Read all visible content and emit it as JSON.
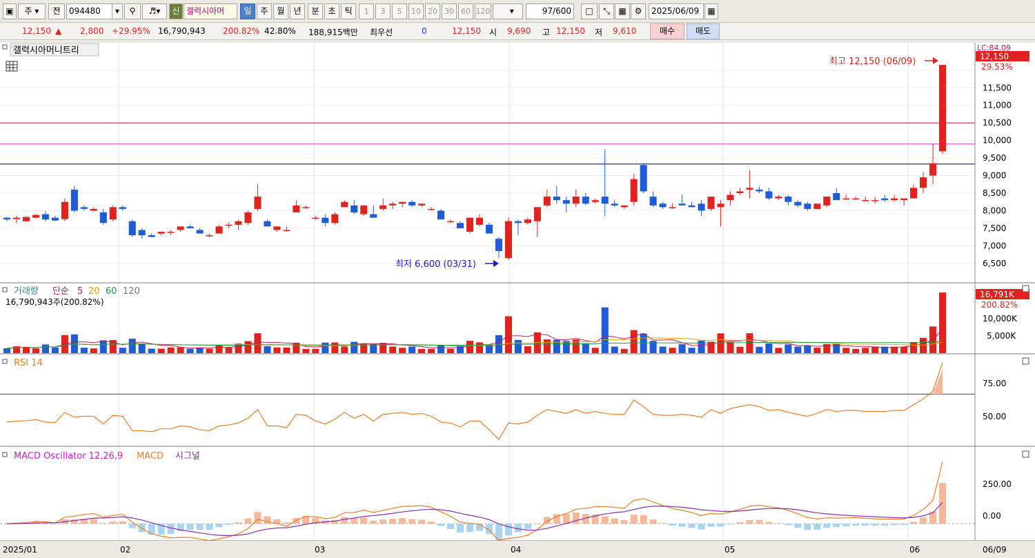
{
  "toolbar": {
    "period_select": "주",
    "prev_label": "전",
    "stock_code": "094480",
    "new_badge": "신",
    "stock_name": "갤럭시아머",
    "period_tabs": [
      "일",
      "주",
      "월",
      "년",
      "분",
      "초",
      "틱"
    ],
    "active_period": "일",
    "interval_buttons": [
      "1",
      "3",
      "5",
      "10",
      "20",
      "30",
      "60",
      "120"
    ],
    "count": "97",
    "count_total": "/600",
    "date": "2025/06/09"
  },
  "quote": {
    "price": "12,150",
    "change": "2,800",
    "change_pct": "+29.95%",
    "volume": "16,790,943",
    "volume_ratio": "200.82%",
    "turnover_pct": "42.80%",
    "amount": "188,915백만",
    "priority_label": "최우선",
    "priority_value": "0",
    "ask_price": "12,150",
    "open_label": "시",
    "open": "9,690",
    "high_label": "고",
    "high": "12,150",
    "low_label": "저",
    "low": "9,610",
    "buy_label": "매수",
    "sell_label": "매도"
  },
  "panels": {
    "price_title": "갤럭시아머니트리",
    "volume_title": "거래량",
    "volume_ma_label": "단순",
    "volume_ma_periods": [
      "5",
      "20",
      "60",
      "120"
    ],
    "volume_info": "16,790,943주(200.82%)",
    "rsi_title": "RSI 14",
    "macd_title": "MACD Oscillator 12,26,9",
    "macd_label": "MACD",
    "signal_label": "시그널"
  },
  "annotations": {
    "high_note": "최고 12,150 (06/09)",
    "low_note": "최저 6,600 (03/31)",
    "lc_label": "LC:84.09",
    "last_price_tag": "12,150",
    "last_pct_tag": "29.53%",
    "volume_tag": "16,791K",
    "volume_pct_tag": "200.82%"
  },
  "axes": {
    "price_ticks": [
      "11,500",
      "11,000",
      "10,500",
      "10,000",
      "9,500",
      "9,000",
      "8,500",
      "8,000",
      "7,500",
      "7,000",
      "6,500"
    ],
    "volume_ticks": [
      "10,000K",
      "5,000K"
    ],
    "rsi_ticks": [
      "75.00",
      "50.00"
    ],
    "macd_ticks": [
      "250.00",
      "0.00"
    ],
    "date_labels": [
      "2025/01",
      "02",
      "03",
      "04",
      "05",
      "06",
      "06/09"
    ]
  },
  "colors": {
    "up": "#e0231c",
    "down": "#1f5cd6",
    "hline_red": "#d64a7a",
    "hline_magenta": "#e052e0",
    "hline_blue": "#2b2a9a",
    "rsi_line": "#f07c22",
    "macd_line": "#f07c22",
    "signal_line": "#8a2bb4",
    "osc_pos": "#f5b89a",
    "osc_neg": "#a9d4f0"
  },
  "chart_data": {
    "type": "candlestick",
    "dates_range": [
      "2025/01",
      "2025/06/09"
    ],
    "candles": [
      [
        7800,
        7820,
        7700,
        7750
      ],
      [
        7760,
        7850,
        7650,
        7800
      ],
      [
        7700,
        7850,
        7680,
        7820
      ],
      [
        7800,
        7900,
        7780,
        7880
      ],
      [
        7900,
        7980,
        7700,
        7750
      ],
      [
        7800,
        7850,
        7700,
        7720
      ],
      [
        7760,
        8350,
        7700,
        8250
      ],
      [
        8600,
        8700,
        7950,
        8000
      ],
      [
        8100,
        8150,
        8000,
        8050
      ],
      [
        8000,
        8100,
        7980,
        8050
      ],
      [
        7950,
        8050,
        7600,
        7650
      ],
      [
        7750,
        8150,
        7700,
        8100
      ],
      [
        8100,
        8150,
        8000,
        8050
      ],
      [
        7700,
        7750,
        7250,
        7300
      ],
      [
        7450,
        7500,
        7200,
        7300
      ],
      [
        7300,
        7350,
        7250,
        7250
      ],
      [
        7350,
        7400,
        7300,
        7400
      ],
      [
        7400,
        7450,
        7300,
        7400
      ],
      [
        7450,
        7550,
        7400,
        7550
      ],
      [
        7550,
        7600,
        7500,
        7500
      ],
      [
        7450,
        7500,
        7350,
        7350
      ],
      [
        7300,
        7350,
        7250,
        7300
      ],
      [
        7350,
        7600,
        7350,
        7550
      ],
      [
        7600,
        7650,
        7500,
        7600
      ],
      [
        7600,
        7750,
        7450,
        7700
      ],
      [
        7650,
        8000,
        7600,
        7950
      ],
      [
        8050,
        8750,
        8000,
        8400
      ],
      [
        7700,
        7750,
        7550,
        7550
      ],
      [
        7450,
        7550,
        7400,
        7550
      ],
      [
        7450,
        7550,
        7400,
        7450
      ],
      [
        7950,
        8300,
        7950,
        8150
      ],
      [
        8100,
        8150,
        8050,
        8100
      ],
      [
        7800,
        7850,
        7750,
        7800
      ],
      [
        7800,
        7900,
        7550,
        7650
      ],
      [
        7650,
        7950,
        7600,
        7900
      ],
      [
        8100,
        8300,
        8100,
        8250
      ],
      [
        8150,
        8300,
        7900,
        7950
      ],
      [
        7900,
        8150,
        7850,
        8150
      ],
      [
        7900,
        8150,
        7850,
        7800
      ],
      [
        8050,
        8350,
        8000,
        8150
      ],
      [
        8150,
        8250,
        8050,
        8200
      ],
      [
        8200,
        8250,
        8100,
        8250
      ],
      [
        8250,
        8300,
        8100,
        8150
      ],
      [
        8150,
        8200,
        8100,
        8200
      ],
      [
        8050,
        8100,
        8000,
        8050
      ],
      [
        8000,
        8050,
        7800,
        7750
      ],
      [
        7700,
        7750,
        7650,
        7700
      ],
      [
        7650,
        7700,
        7500,
        7500
      ],
      [
        7400,
        7750,
        7350,
        7800
      ],
      [
        7600,
        7900,
        7550,
        7800
      ],
      [
        7600,
        7650,
        7400,
        7350
      ],
      [
        7200,
        7250,
        6650,
        6850
      ],
      [
        6650,
        7800,
        6600,
        7700
      ],
      [
        7700,
        7750,
        7300,
        7650
      ],
      [
        7650,
        7800,
        7600,
        7750
      ],
      [
        7700,
        8000,
        7250,
        8100
      ],
      [
        8150,
        8600,
        8100,
        8400
      ],
      [
        8400,
        8700,
        8200,
        8300
      ],
      [
        8300,
        8400,
        7950,
        8200
      ],
      [
        8200,
        8600,
        8100,
        8400
      ],
      [
        8400,
        8500,
        8150,
        8200
      ],
      [
        8250,
        8350,
        8200,
        8300
      ],
      [
        8400,
        9750,
        7850,
        8200
      ],
      [
        8200,
        8300,
        8100,
        8150
      ],
      [
        8100,
        8150,
        8050,
        8150
      ],
      [
        8250,
        9050,
        8150,
        8900
      ],
      [
        9300,
        9350,
        8500,
        8550
      ],
      [
        8400,
        8550,
        8100,
        8150
      ],
      [
        8200,
        8250,
        8050,
        8100
      ],
      [
        8100,
        8200,
        8050,
        8100
      ],
      [
        8200,
        8450,
        8150,
        8150
      ],
      [
        8150,
        8250,
        8100,
        8100
      ],
      [
        8200,
        8300,
        7850,
        8000
      ],
      [
        8050,
        8400,
        8000,
        8400
      ],
      [
        8100,
        8300,
        7550,
        8200
      ],
      [
        8300,
        8550,
        8150,
        8450
      ],
      [
        8500,
        8650,
        8450,
        8550
      ],
      [
        8600,
        9150,
        8350,
        8650
      ],
      [
        8600,
        8700,
        8500,
        8550
      ],
      [
        8550,
        8650,
        8300,
        8350
      ],
      [
        8350,
        8450,
        8300,
        8400
      ],
      [
        8400,
        8450,
        8150,
        8250
      ],
      [
        8250,
        8300,
        8100,
        8150
      ],
      [
        8200,
        8250,
        8000,
        8050
      ],
      [
        8050,
        8200,
        8050,
        8200
      ],
      [
        8150,
        8400,
        8100,
        8400
      ],
      [
        8500,
        8650,
        8300,
        8300
      ],
      [
        8350,
        8450,
        8300,
        8350
      ],
      [
        8350,
        8400,
        8300,
        8350
      ],
      [
        8300,
        8400,
        8250,
        8300
      ],
      [
        8300,
        8400,
        8200,
        8300
      ],
      [
        8350,
        8450,
        8250,
        8300
      ],
      [
        8300,
        8450,
        8250,
        8350
      ],
      [
        8300,
        8350,
        8150,
        8350
      ],
      [
        8350,
        8750,
        8350,
        8650
      ],
      [
        8650,
        9100,
        8500,
        8950
      ],
      [
        9000,
        9900,
        8750,
        9350
      ],
      [
        9690,
        12150,
        9610,
        12150
      ]
    ],
    "hlines": [
      10500,
      9900,
      9330
    ],
    "price_range": [
      6300,
      12350
    ],
    "rsi_range": [
      30,
      100
    ],
    "macd_range": [
      -100,
      520
    ]
  }
}
